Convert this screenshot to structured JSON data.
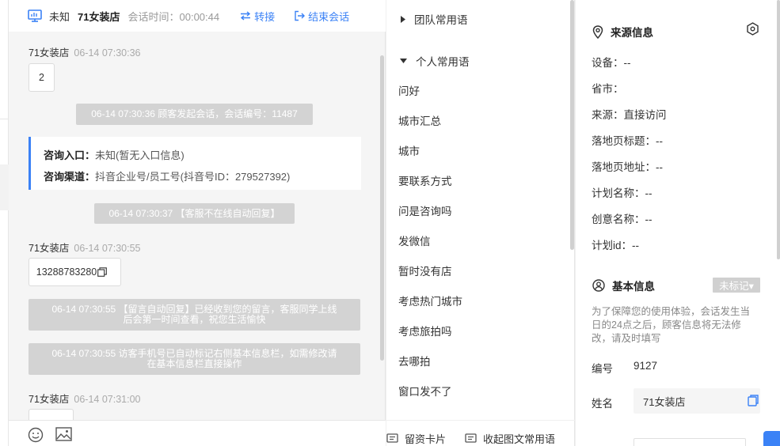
{
  "header": {
    "status": "未知",
    "store_name": "71女装店",
    "session_time_label": "会话时间：",
    "session_time": "00:00:44",
    "transfer_label": "转接",
    "end_label": "结束会话"
  },
  "messages": {
    "m1": {
      "sender": "71女装店",
      "time": "06-14 07:30:36",
      "text": "2"
    },
    "sys1": "06-14 07:30:36 顾客发起会话，会话编号：11487",
    "card": {
      "entry_label": "咨询入口：",
      "entry_value": "未知(暂无入口信息)",
      "channel_label": "咨询渠道：",
      "channel_value": "抖音企业号/员工号(抖音号ID：279527392)"
    },
    "sys2": "06-14 07:30:37 【客服不在线自动回复】",
    "m2": {
      "sender": "71女装店",
      "time": "06-14 07:30:55",
      "text": "13288783280"
    },
    "sys3_line1": "06-14 07:30:55 【留言自动回复】已经收到您的留言，客服同学上线",
    "sys3_line2": "后会第一时间查看，祝您生活愉快",
    "sys4_line1": "06-14 07:30:55 访客手机号已自动标记右侧基本信息栏，如需修改请",
    "sys4_line2": "在基本信息栏直接操作",
    "m3": {
      "sender": "71女装店",
      "time": "06-14 07:31:00"
    }
  },
  "phrases": {
    "team_group": "团队常用语",
    "personal_group": "个人常用语",
    "items": [
      "问好",
      "城市汇总",
      "城市",
      "要联系方式",
      "问是咨询吗",
      "发微信",
      "暂时没有店",
      "考虑热门城市",
      "考虑旅拍吗",
      "去哪拍",
      "窗口发不了"
    ],
    "leave_card": "留资卡片",
    "collapse": "收起图文常用语"
  },
  "source_info": {
    "title": "来源信息",
    "device": "设备：--",
    "province": "省市：",
    "source": "来源：直接访问",
    "landing_title": "落地页标题：--",
    "landing_url": "落地页地址：--",
    "plan_name": "计划名称：--",
    "creative_name": "创意名称：--",
    "plan_id": "计划id：--"
  },
  "basic_info": {
    "title": "基本信息",
    "tag": "未标记▾",
    "notice": "为了保障您的使用体验，会话发生当日的24点之后，顾客信息将无法修改，请及时填写",
    "id_label": "编号",
    "id_value": "9127",
    "name_label": "姓名",
    "name_value": "71女装店"
  },
  "colors": {
    "accent": "#3b82f6",
    "system_msg": "#d3d3d3"
  },
  "icons": [
    "monitor-icon",
    "transfer-icon",
    "exit-icon",
    "copy-icon",
    "emoji-icon",
    "image-icon",
    "card-icon",
    "location-icon",
    "settings-icon",
    "user-icon"
  ]
}
